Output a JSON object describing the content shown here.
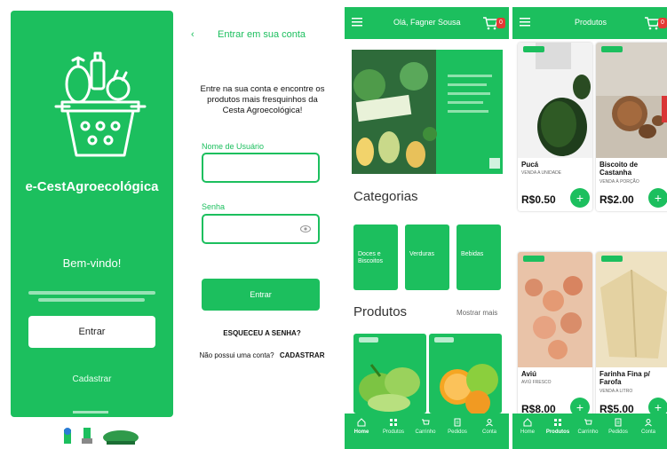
{
  "splash": {
    "brand": "e-CestAgroecológica",
    "welcome": "Bem-vindo!",
    "enter_button": "Entrar",
    "signup_link": "Cadastrar"
  },
  "login": {
    "back_icon": "chevron-left-icon",
    "title": "Entrar em sua conta",
    "intro": "Entre na sua conta e encontre os produtos mais fresquinhos da Cesta Agroecológica!",
    "username_label": "Nome de Usuário",
    "password_label": "Senha",
    "submit": "Entrar",
    "forgot": "ESQUECEU A SENHA?",
    "no_account": "Não possui uma conta?",
    "signup": "CADASTRAR"
  },
  "home": {
    "greeting": "Olá, Fagner Sousa",
    "cart_count": "0",
    "categories_title": "Categorias",
    "categories": [
      "Doces e Biscoitos",
      "Verduras",
      "Bebidas"
    ],
    "products_title": "Produtos",
    "show_more": "Mostrar mais",
    "nav": [
      "Home",
      "Produtos",
      "Carrinho",
      "Pedidos",
      "Conta"
    ]
  },
  "products": {
    "title": "Produtos",
    "cart_count": "0",
    "items": [
      {
        "name": "Pucá",
        "unit": "VENDA A UNIDADE",
        "price": "R$0.50"
      },
      {
        "name": "Biscoito de Castanha",
        "unit": "VENDA À PORÇÃO",
        "price": "R$2.00"
      },
      {
        "name": "Aviú",
        "unit": "AVIÚ FRESCO",
        "price": "R$8.00"
      },
      {
        "name": "Farinha Fina p/ Farofa",
        "unit": "VENDA A LITRO",
        "price": "R$5.00"
      }
    ],
    "nav": [
      "Home",
      "Produtos",
      "Carrinho",
      "Pedidos",
      "Conta"
    ]
  },
  "colors": {
    "accent": "#1cbf5e",
    "badge": "#e53935"
  }
}
